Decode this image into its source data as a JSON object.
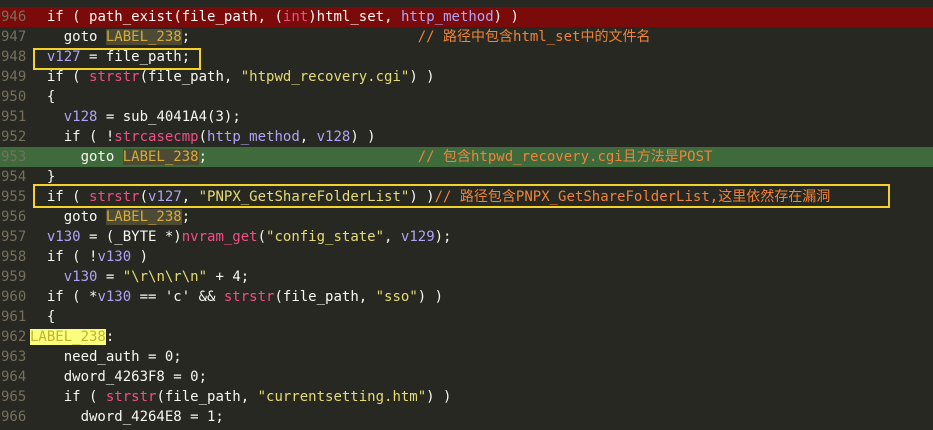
{
  "colors": {
    "background": "#272822",
    "line_number": "#74705d",
    "highlight_red": "#7b0a0a",
    "highlight_green": "#3f6a3c",
    "annotation_box": "#f3d22c",
    "keyword": "#f8f8f2",
    "variable": "#b1a3f6",
    "function": "#f24f8a",
    "string": "#e6db74",
    "comment": "#f0833a",
    "label": "#d5ac3a"
  },
  "lines": [
    {
      "num": "946",
      "hl": "red",
      "tokens": [
        {
          "t": "  if ( ",
          "c": "def"
        },
        {
          "t": "path_exist",
          "c": "def"
        },
        {
          "t": "(",
          "c": "def"
        },
        {
          "t": "file_path",
          "c": "def"
        },
        {
          "t": ", (",
          "c": "def"
        },
        {
          "t": "int",
          "c": "fn"
        },
        {
          "t": ")",
          "c": "def"
        },
        {
          "t": "html_set",
          "c": "def"
        },
        {
          "t": ", ",
          "c": "def"
        },
        {
          "t": "http_method",
          "c": "var"
        },
        {
          "t": ") )",
          "c": "def"
        }
      ]
    },
    {
      "num": "947",
      "hl": "",
      "tokens": [
        {
          "t": "    goto ",
          "c": "def"
        },
        {
          "t": "LABEL_238",
          "c": "lbl"
        },
        {
          "t": ";                           ",
          "c": "def"
        },
        {
          "t": "// 路径中包含html_set中的文件名",
          "c": "cm"
        }
      ]
    },
    {
      "num": "948",
      "hl": "",
      "tokens": [
        {
          "t": "  ",
          "c": "def"
        },
        {
          "t": "v127",
          "c": "var"
        },
        {
          "t": " = ",
          "c": "def"
        },
        {
          "t": "file_path",
          "c": "def"
        },
        {
          "t": ";",
          "c": "def"
        }
      ]
    },
    {
      "num": "949",
      "hl": "",
      "tokens": [
        {
          "t": "  if ( ",
          "c": "def"
        },
        {
          "t": "strstr",
          "c": "fn"
        },
        {
          "t": "(",
          "c": "def"
        },
        {
          "t": "file_path",
          "c": "def"
        },
        {
          "t": ", ",
          "c": "def"
        },
        {
          "t": "\"htpwd_recovery.cgi\"",
          "c": "str"
        },
        {
          "t": ") )",
          "c": "def"
        }
      ]
    },
    {
      "num": "950",
      "hl": "",
      "tokens": [
        {
          "t": "  {",
          "c": "def"
        }
      ]
    },
    {
      "num": "951",
      "hl": "",
      "tokens": [
        {
          "t": "    ",
          "c": "def"
        },
        {
          "t": "v128",
          "c": "var"
        },
        {
          "t": " = ",
          "c": "def"
        },
        {
          "t": "sub_4041A4",
          "c": "def"
        },
        {
          "t": "(3);",
          "c": "def"
        }
      ]
    },
    {
      "num": "952",
      "hl": "",
      "tokens": [
        {
          "t": "    if ( !",
          "c": "def"
        },
        {
          "t": "strcasecmp",
          "c": "fn"
        },
        {
          "t": "(",
          "c": "def"
        },
        {
          "t": "http_method",
          "c": "var"
        },
        {
          "t": ", ",
          "c": "def"
        },
        {
          "t": "v128",
          "c": "var"
        },
        {
          "t": ") )",
          "c": "def"
        }
      ]
    },
    {
      "num": "953",
      "hl": "green",
      "tokens": [
        {
          "t": "      goto ",
          "c": "def"
        },
        {
          "t": "LABEL_238",
          "c": "lbl"
        },
        {
          "t": ";                         ",
          "c": "def"
        },
        {
          "t": "// 包含htpwd_recovery.cgi且方法是POST",
          "c": "cm"
        }
      ]
    },
    {
      "num": "954",
      "hl": "",
      "tokens": [
        {
          "t": "  }",
          "c": "def"
        }
      ]
    },
    {
      "num": "955",
      "hl": "",
      "tokens": [
        {
          "t": "  if ( ",
          "c": "def"
        },
        {
          "t": "strstr",
          "c": "fn"
        },
        {
          "t": "(",
          "c": "def"
        },
        {
          "t": "v127",
          "c": "var"
        },
        {
          "t": ", ",
          "c": "def"
        },
        {
          "t": "\"PNPX_GetShareFolderList\"",
          "c": "str"
        },
        {
          "t": ") )",
          "c": "def"
        },
        {
          "t": "// 路径包含PNPX_GetShareFolderList,这里依然存在漏洞",
          "c": "cm"
        }
      ]
    },
    {
      "num": "956",
      "hl": "",
      "tokens": [
        {
          "t": "    goto ",
          "c": "def"
        },
        {
          "t": "LABEL_238",
          "c": "lbl"
        },
        {
          "t": ";",
          "c": "def"
        }
      ]
    },
    {
      "num": "957",
      "hl": "",
      "tokens": [
        {
          "t": "  ",
          "c": "def"
        },
        {
          "t": "v130",
          "c": "var"
        },
        {
          "t": " = (_BYTE *)",
          "c": "def"
        },
        {
          "t": "nvram_get",
          "c": "fn"
        },
        {
          "t": "(",
          "c": "def"
        },
        {
          "t": "\"config_state\"",
          "c": "str"
        },
        {
          "t": ", ",
          "c": "def"
        },
        {
          "t": "v129",
          "c": "var"
        },
        {
          "t": ");",
          "c": "def"
        }
      ]
    },
    {
      "num": "958",
      "hl": "",
      "tokens": [
        {
          "t": "  if ( !",
          "c": "def"
        },
        {
          "t": "v130",
          "c": "var"
        },
        {
          "t": " )",
          "c": "def"
        }
      ]
    },
    {
      "num": "959",
      "hl": "",
      "tokens": [
        {
          "t": "    ",
          "c": "def"
        },
        {
          "t": "v130",
          "c": "var"
        },
        {
          "t": " = ",
          "c": "def"
        },
        {
          "t": "\"\\r\\n\\r\\n\"",
          "c": "str"
        },
        {
          "t": " + 4;",
          "c": "def"
        }
      ]
    },
    {
      "num": "960",
      "hl": "",
      "tokens": [
        {
          "t": "  if ( *",
          "c": "def"
        },
        {
          "t": "v130",
          "c": "var"
        },
        {
          "t": " == 'c' && ",
          "c": "def"
        },
        {
          "t": "strstr",
          "c": "fn"
        },
        {
          "t": "(",
          "c": "def"
        },
        {
          "t": "file_path",
          "c": "def"
        },
        {
          "t": ", ",
          "c": "def"
        },
        {
          "t": "\"sso\"",
          "c": "str"
        },
        {
          "t": ") )",
          "c": "def"
        }
      ]
    },
    {
      "num": "961",
      "hl": "",
      "tokens": [
        {
          "t": "  {",
          "c": "def"
        }
      ]
    },
    {
      "num": "962",
      "hl": "",
      "tokens": [
        {
          "t": "LABEL_238",
          "c": "lbl-bright"
        },
        {
          "t": ":",
          "c": "def"
        }
      ]
    },
    {
      "num": "963",
      "hl": "",
      "tokens": [
        {
          "t": "    need_auth = 0;",
          "c": "def"
        }
      ]
    },
    {
      "num": "964",
      "hl": "",
      "tokens": [
        {
          "t": "    dword_4263F8 = 0;",
          "c": "def"
        }
      ]
    },
    {
      "num": "965",
      "hl": "",
      "tokens": [
        {
          "t": "    if ( ",
          "c": "def"
        },
        {
          "t": "strstr",
          "c": "fn"
        },
        {
          "t": "(",
          "c": "def"
        },
        {
          "t": "file_path",
          "c": "def"
        },
        {
          "t": ", ",
          "c": "def"
        },
        {
          "t": "\"currentsetting.htm\"",
          "c": "str"
        },
        {
          "t": ") )",
          "c": "def"
        }
      ]
    },
    {
      "num": "966",
      "hl": "",
      "tokens": [
        {
          "t": "      dword_4264E8 = 1;",
          "c": "def"
        }
      ]
    }
  ]
}
